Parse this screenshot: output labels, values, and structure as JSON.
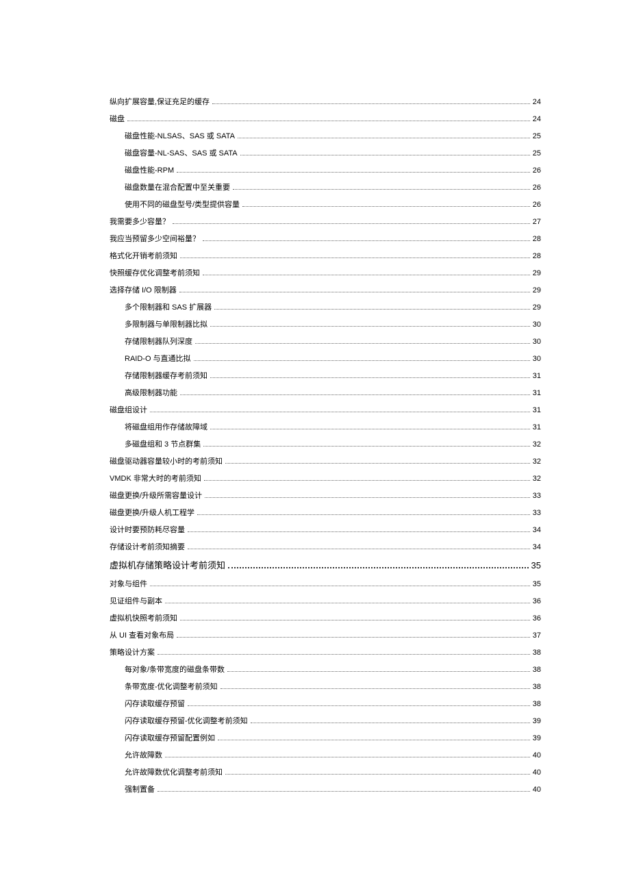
{
  "toc": [
    {
      "level": 1,
      "title": "纵向扩展容量,保证充足的缓存",
      "page": "24"
    },
    {
      "level": 1,
      "title": "磁盘",
      "page": "24"
    },
    {
      "level": 2,
      "title": "磁盘性能-NLSAS、SAS 或 SATA",
      "page": "25"
    },
    {
      "level": 2,
      "title": "磁盘容量-NL-SAS、SAS 或 SATA",
      "page": "25"
    },
    {
      "level": 2,
      "title": "磁盘性能-RPM",
      "page": "26"
    },
    {
      "level": 2,
      "title": "磁盘数量在混合配置中至关重要",
      "page": "26"
    },
    {
      "level": 2,
      "title": "使用不同的磁盘型号/类型提供容量",
      "page": "26"
    },
    {
      "level": 1,
      "title": "我需要多少容量？",
      "page": "27"
    },
    {
      "level": 1,
      "title": "我应当预留多少空间裕量？",
      "page": "28"
    },
    {
      "level": 1,
      "title": "格式化开销考前须知",
      "page": "28"
    },
    {
      "level": 1,
      "title": "快照缓存优化调整考前须知",
      "page": "29"
    },
    {
      "level": 1,
      "title": "选择存储 I/O 限制器",
      "page": "29"
    },
    {
      "level": 2,
      "title": "多个限制器和 SAS 扩展器",
      "page": "29"
    },
    {
      "level": 2,
      "title": "多限制器与单限制器比拟",
      "page": "30"
    },
    {
      "level": 2,
      "title": "存储限制器队列深度",
      "page": "30"
    },
    {
      "level": 2,
      "title": "RAID-O 与直通比拟",
      "page": "30"
    },
    {
      "level": 2,
      "title": "存储限制器缓存考前须知",
      "page": "31"
    },
    {
      "level": 2,
      "title": "高级限制器功能",
      "page": "31"
    },
    {
      "level": 1,
      "title": "磁盘组设计",
      "page": "31"
    },
    {
      "level": 2,
      "title": "将磁盘组用作存储故障域",
      "page": "31"
    },
    {
      "level": 2,
      "title": "多磁盘组和 3 节点群集",
      "page": "32"
    },
    {
      "level": 1,
      "title": "磁盘驱动器容量较小时的考前须知",
      "page": "32"
    },
    {
      "level": 1,
      "title": "VMDK 非常大时的考前须知",
      "page": "32"
    },
    {
      "level": 1,
      "title": "磁盘更换/升级所需容量设计",
      "page": "33"
    },
    {
      "level": 1,
      "title": "磁盘更换/升级人机工程学",
      "page": "33"
    },
    {
      "level": 1,
      "title": "设计时要预防耗尽容量",
      "page": "34"
    },
    {
      "level": 1,
      "title": "存储设计考前须知摘要",
      "page": "34"
    },
    {
      "level": 0,
      "title": "虚拟机存储策略设计考前须知",
      "page": "35"
    },
    {
      "level": 1,
      "title": "对象与组件",
      "page": "35"
    },
    {
      "level": 1,
      "title": "见证组件与副本",
      "page": "36"
    },
    {
      "level": 1,
      "title": "虚拟机快照考前须知",
      "page": "36"
    },
    {
      "level": 1,
      "title": "从 UI 查看对象布局",
      "page": "37"
    },
    {
      "level": 1,
      "title": "策略设计方案",
      "page": "38"
    },
    {
      "level": 2,
      "title": "每对象/条带宽度的磁盘条带数",
      "page": "38"
    },
    {
      "level": 2,
      "title": "条带宽度-优化调整考前须知",
      "page": "38"
    },
    {
      "level": 2,
      "title": "闪存读取缓存预留",
      "page": "38"
    },
    {
      "level": 2,
      "title": "闪存读取缓存预留-优化调整考前须知",
      "page": "39"
    },
    {
      "level": 2,
      "title": "闪存读取缓存预留配置例如",
      "page": "39"
    },
    {
      "level": 2,
      "title": "允许故障数",
      "page": "40"
    },
    {
      "level": 2,
      "title": "允许故障数优化调整考前须知",
      "page": "40"
    },
    {
      "level": 2,
      "title": "强制置备",
      "page": "40"
    }
  ]
}
